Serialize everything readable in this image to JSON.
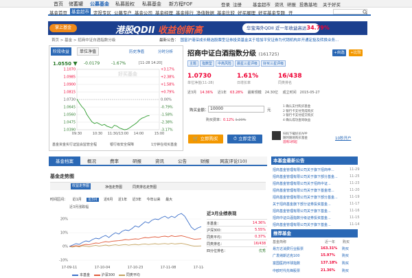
{
  "top_nav": {
    "items": [
      "首页",
      "储蓄罐",
      "公募基金",
      "私募股权",
      "私募基金",
      "新方程FOF"
    ],
    "right": [
      "登录",
      "注册",
      "基金超市",
      "资讯",
      "研报",
      "投教基地",
      "关于好买"
    ]
  },
  "sub_nav": [
    "基金首页",
    "基金超市",
    "定投专区",
    "公募专户",
    "基金公司",
    "基金经理",
    "基金排行",
    "净值数据",
    "基金比较",
    "好买履理",
    "好买基金专题",
    "开"
  ],
  "banner": {
    "pill": "掌上基金",
    "headline_pre": "港股QDII ",
    "headline_hl": "收益创新高",
    "box_text": "华宝海外QDII 近一年收益高达",
    "box_value": "34.79%"
  },
  "breadcrumb": "首页 > 基金 > 招商中证白酒指数分级",
  "notice": {
    "label": "最新公告：",
    "text": "国富沪港深成长精选股票型证券投资基金关于增加平安证券为代销机构并开通定投及转换业务..."
  },
  "chart_panel": {
    "tabs": [
      "阶段收益",
      "单位净值"
    ],
    "links": [
      "历史净值",
      "分时分析"
    ],
    "nav": "1.0550",
    "change": "-0.0179",
    "change_pct": "-1.67%",
    "time": "[11-28 14:20]",
    "watermark": "好买基金",
    "y_left": [
      "1.1070",
      "1.0985",
      "1.0900",
      "1.0815",
      "1.0730",
      "1.0645",
      "1.0560",
      "1.0475",
      "1.0390"
    ],
    "y_right": [
      "+3.17%",
      "+2.38%",
      "+1.58%",
      "+0.79%",
      "0.00%",
      "-0.79%",
      "-1.58%",
      "-2.38%",
      "-3.17%"
    ],
    "x_ticks": [
      "09:30",
      "10:30",
      "11:30/13:00",
      "14:00",
      "15:00"
    ],
    "notes": [
      "基金资金实行证监会监管全程",
      "银行级安全保障",
      "1分钟在线买基金"
    ]
  },
  "fund": {
    "name": "招商中证白酒指数分级",
    "code": "(161725)",
    "buttons": [
      "+自选",
      "+比较"
    ],
    "tags": [
      "主题",
      "指数型",
      "中高风险",
      "晨星三星评级",
      "好买三星评级"
    ],
    "unit_nav": "1.0730",
    "unit_nav_label": "单位净值(11-28)",
    "day_growth": "1.61%",
    "day_growth_label": "日增长率",
    "rank": "16/438",
    "rank_label": "同类排名",
    "stats": [
      [
        "近3月",
        "14.36%"
      ],
      [
        "近1年",
        "63.28%"
      ],
      [
        "最新规模",
        "24.30亿"
      ],
      [
        "成立时间",
        "2015-05-27"
      ]
    ]
  },
  "buy": {
    "label": "购买金额：",
    "amount": "10000",
    "unit": "元",
    "fee_text": "购买费率：",
    "fee_now": "0.12%",
    "fee_orig": "1.20%",
    "steps": [
      "1 确认支付购买基金",
      "2 银行卡支付完成购买",
      "3 银行卡支付提交购买",
      "4 确认成功查询收益"
    ],
    "buy_btn": "立即购买",
    "plan_btn": "立即定投",
    "qr_text": "扫码下载好买APP",
    "qr_offer": "首购1折起",
    "qr_extra": "随时随地购买基金",
    "jump": "10秒开户"
  },
  "main_tabs": [
    "基金档案",
    "概况",
    "费率",
    "研报",
    "资讯",
    "公告",
    "财报",
    "网友评论(10)"
  ],
  "trend": {
    "title": "基金走势图",
    "subtabs": [
      "收益走势图",
      "净值走势图",
      "同类排名走势图"
    ],
    "range_label": "时间区间：",
    "ranges": [
      "近1月",
      "近3月",
      "近6月",
      "近1年",
      "近3年",
      "今年以来",
      "最大"
    ],
    "chart_label": "近3月涨跌幅",
    "y_ticks": [
      "20%",
      "10%",
      "0%",
      "-10%"
    ],
    "x_ticks": [
      "17-09-11",
      "17-10-04",
      "17-10-23",
      "17-11-08",
      "17-11-20"
    ],
    "legend": [
      [
        "本基金",
        "#3b6fc9"
      ],
      [
        "沪深300",
        "#e05a3a"
      ],
      [
        "同类平均",
        "#c3a25e"
      ]
    ],
    "perf_title": "近3月业绩表现",
    "perf": [
      [
        "本基金：",
        "14.36%"
      ],
      [
        "沪深300：",
        "5.55%"
      ],
      [
        "同类平均：",
        "0.37%"
      ],
      [
        "同类排名：",
        "16/438"
      ]
    ],
    "perf_note": "四分位排名：",
    "perf_note_value": "优秀",
    "series_fund": [
      0,
      1,
      2,
      1.5,
      3,
      4,
      3.5,
      5,
      6,
      5.5,
      7,
      8,
      6.5,
      8.5,
      10,
      9,
      11,
      12,
      11.5,
      13,
      15,
      14,
      16,
      18,
      17,
      19,
      20,
      19.5,
      21,
      22,
      20.5,
      22,
      21,
      23,
      24,
      22,
      18,
      14,
      12,
      13.5,
      14.4
    ],
    "series_hs": [
      0,
      0.2,
      0.5,
      0.3,
      1,
      1.5,
      1.2,
      2,
      2.5,
      2.3,
      3,
      3.5,
      3.2,
      3.8,
      4,
      4.2,
      4.5,
      5,
      4.8,
      5.2,
      5.5,
      5.3,
      6,
      6.5,
      6.2,
      6.8,
      7,
      6.6,
      7.2,
      7.5,
      7,
      7.8,
      7.2,
      7.5,
      7.8,
      7.2,
      6.5,
      5.8,
      5.2,
      5.4,
      5.6
    ],
    "series_avg": [
      0,
      -0.5,
      0.2,
      -0.3,
      0.5,
      0.2,
      -0.2,
      0.4,
      0.8,
      0.3,
      0.6,
      1,
      0.5,
      0.9,
      1.2,
      0.8,
      1.1,
      1.4,
      0.9,
      1.3,
      1.5,
      1.1,
      1.6,
      1.8,
      1.4,
      1.7,
      2,
      1.6,
      1.9,
      2.1,
      1.7,
      2.2,
      1.8,
      2,
      2.2,
      1.8,
      1.2,
      0.6,
      0.2,
      0.3,
      0.4
    ]
  },
  "sidebar": {
    "ann_title": "本基金最新公告",
    "announcements": [
      [
        "招商基金管理有限公司关于旗下招商申...",
        "11-29"
      ],
      [
        "招商基金管理有限公司关于旗下部分基金...",
        "11-25"
      ],
      [
        "招商基金管理有限公司关于招商中证...",
        "11-23"
      ],
      [
        "招商基金管理有限公司关于旗下基金增...",
        "11-20"
      ],
      [
        "招商基金管理有限公司关于旗下部分基金...",
        "11-19"
      ],
      [
        "关于招商基金旗下部分证券投资基金...",
        "11-17"
      ],
      [
        "招商基金管理有限公司关于旗下基金...",
        "11-16"
      ],
      [
        "招商中证白酒指数分级证券投资基金...",
        "11-15"
      ],
      [
        "招商基金管理有限公司关于旗下基金...",
        "11-14"
      ]
    ],
    "rec_title": "推荐基金",
    "rec_head": [
      "基金简称",
      "近一年",
      "购买"
    ],
    "recs": [
      [
        "易方达消费行业股票",
        "163.31%",
        "购买"
      ],
      [
        "广发纳斯达克100",
        "15.97%",
        "购买"
      ],
      [
        "富国医药环球指数",
        "137.18%",
        "购买"
      ],
      [
        "中欧时代先锋股票",
        "21.36%",
        "购买"
      ]
    ]
  },
  "colors": {
    "brand": "#2a68b5",
    "up": "#e03",
    "down": "#2a7a2a",
    "accent": "#f39800"
  }
}
